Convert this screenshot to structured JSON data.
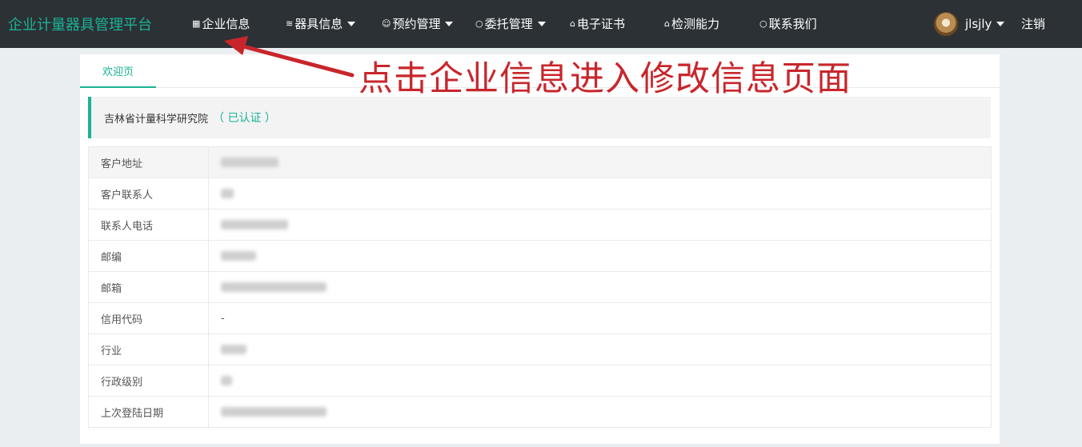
{
  "brand": "企业计量器具管理平台",
  "nav": {
    "company_info": "企业信息",
    "instruments": "器具信息",
    "booking": "预约管理",
    "entrust": "委托管理",
    "certificate": "电子证书",
    "capability": "检测能力",
    "contact": "联系我们"
  },
  "user": {
    "name": "jlsjly",
    "logout": "注销"
  },
  "annotation": "点击企业信息进入修改信息页面",
  "tabs": {
    "welcome": "欢迎页"
  },
  "company": {
    "name": "吉林省计量科学研究院",
    "status": "（ 已认证 ）"
  },
  "info_rows": [
    {
      "label": "客户地址",
      "value": ""
    },
    {
      "label": "客户联系人",
      "value": ""
    },
    {
      "label": "联系人电话",
      "value": ""
    },
    {
      "label": "邮编",
      "value": ""
    },
    {
      "label": "邮箱",
      "value": ""
    },
    {
      "label": "信用代码",
      "value": "-"
    },
    {
      "label": "行业",
      "value": ""
    },
    {
      "label": "行政级别",
      "value": ""
    },
    {
      "label": "上次登陆日期",
      "value": ""
    }
  ],
  "colors": {
    "navbar": "#2c3136",
    "accent": "#1ab394",
    "annotation": "#c8262c"
  },
  "icons": {
    "company_info": "grid-icon",
    "instruments": "layers-icon",
    "booking": "smile-icon",
    "entrust": "circle-icon",
    "certificate": "home-icon",
    "capability": "home-icon",
    "contact": "circle-icon"
  }
}
